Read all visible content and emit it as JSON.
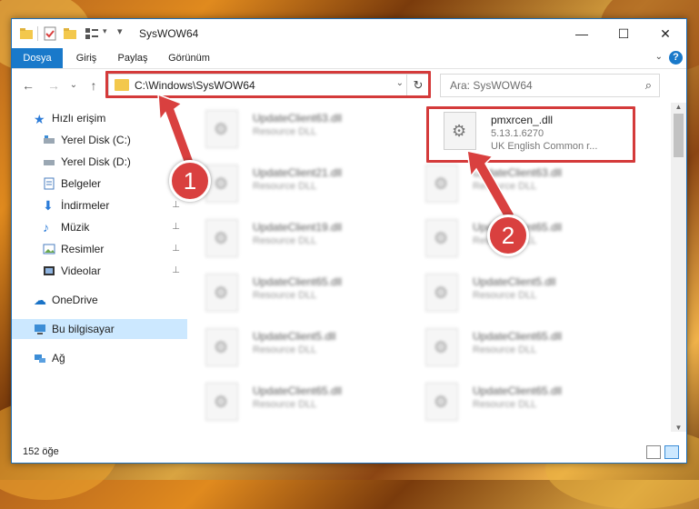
{
  "window": {
    "title": "SysWOW64",
    "controls": {
      "minimize": "—",
      "maximize": "☐",
      "close": "✕"
    }
  },
  "ribbon": {
    "tabs": [
      "Dosya",
      "Giriş",
      "Paylaş",
      "Görünüm"
    ],
    "active_tab": "Dosya",
    "help": "?",
    "expand": "⌄"
  },
  "nav": {
    "back": "←",
    "forward": "→",
    "recent": "⌄",
    "up": "↑",
    "address": "C:\\Windows\\SysWOW64",
    "search_placeholder": "Ara: SysWOW64",
    "refresh": "↻",
    "dropdown": "⌄"
  },
  "sidebar": {
    "items": [
      {
        "label": "Hızlı erişim",
        "icon": "star-icon",
        "pinned": false
      },
      {
        "label": "Yerel Disk (C:)",
        "icon": "drive-icon",
        "pinned": false
      },
      {
        "label": "Yerel Disk (D:)",
        "icon": "drive-icon",
        "pinned": false
      },
      {
        "label": "Belgeler",
        "icon": "document-icon",
        "pinned": false
      },
      {
        "label": "İndirmeler",
        "icon": "download-icon",
        "pinned": true
      },
      {
        "label": "Müzik",
        "icon": "music-icon",
        "pinned": true
      },
      {
        "label": "Resimler",
        "icon": "pictures-icon",
        "pinned": true
      },
      {
        "label": "Videolar",
        "icon": "video-icon",
        "pinned": true
      },
      {
        "label": "OneDrive",
        "icon": "cloud-icon",
        "pinned": false
      },
      {
        "label": "Bu bilgisayar",
        "icon": "computer-icon",
        "pinned": false,
        "selected": true
      },
      {
        "label": "Ağ",
        "icon": "network-icon",
        "pinned": false
      }
    ],
    "pin_glyph": "📌"
  },
  "files": {
    "left_column": [
      {
        "name": "UpdateClient63.dll",
        "type": "Resource DLL"
      },
      {
        "name": "UpdateClient21.dll",
        "type": "Resource DLL"
      },
      {
        "name": "UpdateClient19.dll",
        "type": "Resource DLL"
      },
      {
        "name": "UpdateClient65.dll",
        "type": "Resource DLL"
      },
      {
        "name": "UpdateClient5.dll",
        "type": "Resource DLL"
      },
      {
        "name": "UpdateClient65.dll",
        "type": "Resource DLL"
      }
    ],
    "right_column": [
      {
        "name": "UpdateClient63.dll",
        "type": "Resource DLL"
      },
      {
        "name": "UpdateClient65.dll",
        "type": "Resource DLL"
      },
      {
        "name": "UpdateClient5.dll",
        "type": "Resource DLL"
      },
      {
        "name": "UpdateClient65.dll",
        "type": "Resource DLL"
      },
      {
        "name": "UpdateClient65.dll",
        "type": "Resource DLL"
      }
    ],
    "highlighted": {
      "name": "pmxrcen_.dll",
      "version": "5.13.1.6270",
      "description": "UK English Common r..."
    }
  },
  "status": {
    "count": "152 öğe"
  },
  "annotations": {
    "badge1": "1",
    "badge2": "2",
    "color": "#d9403f"
  }
}
